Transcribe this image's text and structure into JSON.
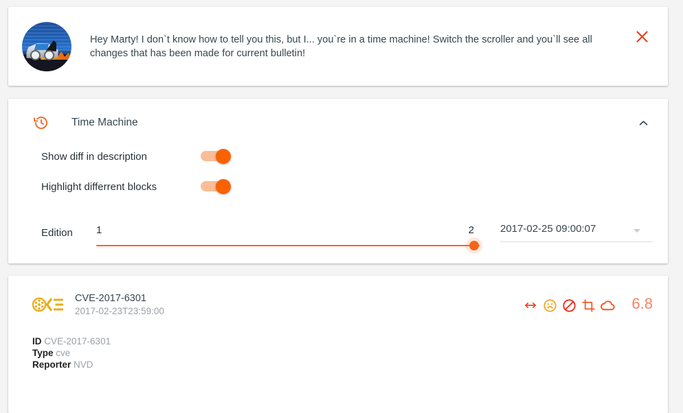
{
  "banner": {
    "avatar_icon": "delorean-time-machine-avatar",
    "message": "Hey Marty! I don`t know how to tell you this, but I... you`re in a time machine! Switch the scroller and you`ll see all changes that has been made for current bulletin!",
    "close_icon": "close-icon",
    "close_color": "#e8431f"
  },
  "time_machine": {
    "header_icon": "history-restore-icon",
    "title": "Time Machine",
    "collapse_icon": "chevron-up-icon",
    "accent_color": "#f4651a",
    "options": [
      {
        "label": "Show diff in description",
        "enabled": true
      },
      {
        "label": "Highlight differrent blocks",
        "enabled": true
      }
    ],
    "edition": {
      "label": "Edition",
      "min": "1",
      "max": "2",
      "value": 2,
      "select_value": "2017-02-25 09:00:07",
      "caret_icon": "chevron-down-icon"
    }
  },
  "bulletin": {
    "logo_icon": "cve-logo-icon",
    "id": "CVE-2017-6301",
    "date": "2017-02-23T23:59:00",
    "icons": [
      {
        "name": "network-arrows-icon",
        "color": "#f0421c"
      },
      {
        "name": "frowning-face-icon",
        "color": "#f7a01c"
      },
      {
        "name": "block-forbidden-icon",
        "color": "#ee2b17"
      },
      {
        "name": "crop-icon",
        "color": "#f4551c"
      },
      {
        "name": "cloud-icon",
        "color": "#f4551c"
      }
    ],
    "score": "6.8",
    "score_color": "#fa8260",
    "fields": [
      {
        "key": "ID",
        "value": "CVE-2017-6301"
      },
      {
        "key": "Type",
        "value": "cve"
      },
      {
        "key": "Reporter",
        "value": "NVD"
      }
    ]
  }
}
